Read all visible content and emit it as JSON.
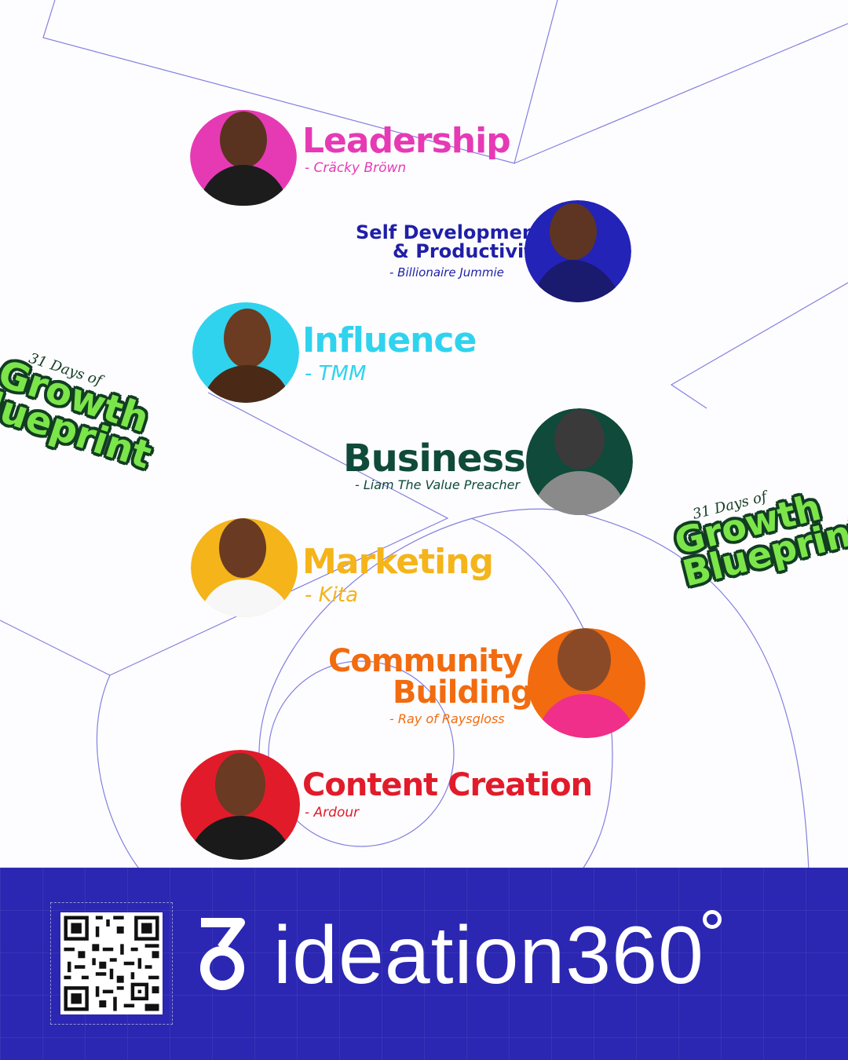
{
  "speakers": [
    {
      "topic": "Leadership",
      "name": "- Cräcky Bröwn",
      "color": "#e63ab5",
      "ring": "#e63ab5"
    },
    {
      "topic_line1": "Self Development",
      "topic_line2": "& Productivity",
      "name": "- Billionaire Jummie",
      "color": "#1f1fa8",
      "ring": "#2323b8"
    },
    {
      "topic": "Influence",
      "name": "- TMM",
      "color": "#2fd3ee",
      "ring": "#2fd3ee"
    },
    {
      "topic": "Business",
      "name": "- Liam The Value Preacher",
      "color": "#0f4a3a",
      "ring": "#0f4a3a"
    },
    {
      "topic": "Marketing",
      "name": "- Kita",
      "color": "#f4b41a",
      "ring": "#f4b41a"
    },
    {
      "topic_line1": "Community",
      "topic_line2": "Building",
      "name": "- Ray of Raysgloss",
      "color": "#f26b0f",
      "ring": "#f26b0f"
    },
    {
      "topic": "Content Creation",
      "name": "- Ardour",
      "color": "#e21b2a",
      "ring": "#e21b2a"
    }
  ],
  "sticker": {
    "small": "31 Days of",
    "line1": "Growth",
    "line2": "Blueprint",
    "line2_cropped": "lueprint"
  },
  "footer": {
    "brand": "ideation360",
    "brand_icon": "ideation360-logo-3-icon",
    "qr_icon": "qr-code-icon",
    "bg": "#2b27b2"
  }
}
